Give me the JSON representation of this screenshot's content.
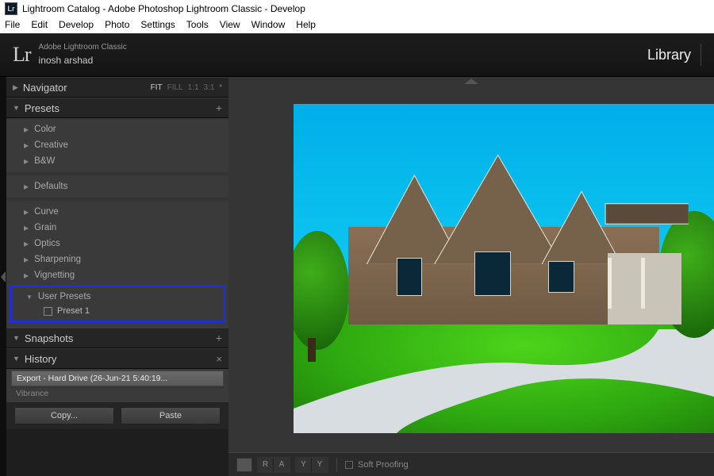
{
  "window": {
    "title": "Lightroom Catalog - Adobe Photoshop Lightroom Classic - Develop",
    "logo_text": "Lr"
  },
  "menubar": [
    "File",
    "Edit",
    "Develop",
    "Photo",
    "Settings",
    "Tools",
    "View",
    "Window",
    "Help"
  ],
  "header": {
    "logo": "Lr",
    "app_line1": "Adobe Lightroom Classic",
    "user": "inosh arshad",
    "module": "Library"
  },
  "navigator": {
    "title": "Navigator",
    "zoom": [
      "FIT",
      "FILL",
      "1:1",
      "3:1"
    ],
    "active": "FIT"
  },
  "presets_panel": {
    "title": "Presets",
    "groups1": [
      "Color",
      "Creative",
      "B&W"
    ],
    "groups2": [
      "Defaults"
    ],
    "groups3": [
      "Curve",
      "Grain",
      "Optics",
      "Sharpening",
      "Vignetting"
    ],
    "user": {
      "title": "User Presets",
      "items": [
        "Preset 1"
      ]
    }
  },
  "snapshots": {
    "title": "Snapshots"
  },
  "history": {
    "title": "History",
    "items": [
      "Export - Hard Drive (26-Jun-21 5:40:19...",
      "Vibrance"
    ]
  },
  "buttons": {
    "copy": "Copy...",
    "paste": "Paste"
  },
  "toolbar": {
    "compare": [
      "R",
      "A",
      "Y",
      "Y"
    ],
    "soft_proof": "Soft Proofing"
  }
}
